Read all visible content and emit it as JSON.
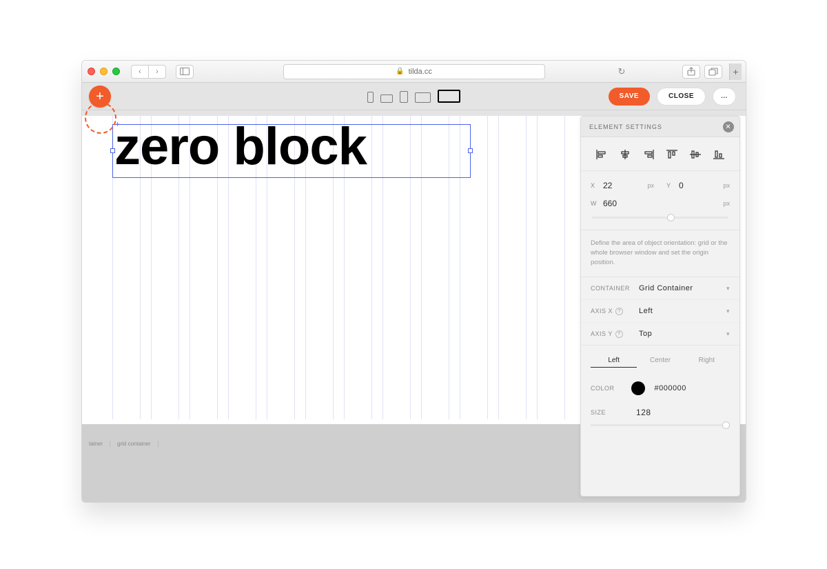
{
  "browser": {
    "url": "tilda.cc"
  },
  "toolbar": {
    "save": "SAVE",
    "close": "CLOSE",
    "more": "..."
  },
  "canvas": {
    "text": "zero block"
  },
  "footer": {
    "l1": "tainer",
    "l2": "grid container"
  },
  "panel": {
    "title": "ELEMENT SETTINGS",
    "x_label": "X",
    "x_value": "22",
    "y_label": "Y",
    "y_value": "0",
    "w_label": "W",
    "w_value": "660",
    "px": "px",
    "description": "Define the area of object orientation: grid or the whole browser window and set the origin position.",
    "container_label": "CONTAINER",
    "container_value": "Grid Container",
    "axisx_label": "AXIS X",
    "axisx_value": "Left",
    "axisy_label": "AXIS Y",
    "axisy_value": "Top",
    "tab_left": "Left",
    "tab_center": "Center",
    "tab_right": "Right",
    "color_label": "COLOR",
    "color_value": "#000000",
    "size_label": "SIZE",
    "size_value": "128"
  }
}
